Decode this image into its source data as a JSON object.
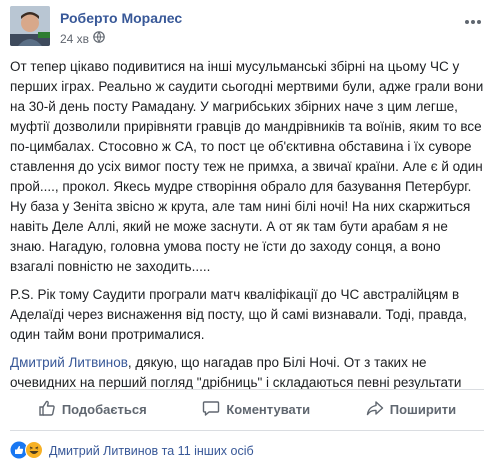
{
  "post": {
    "author": "Роберто Моралес",
    "time": "24 хв",
    "paragraphs": [
      "От тепер цікаво подивитися на інші мусульманські збірні на цьому ЧС у перших іграх. Реально ж саудити сьогодні мертвими були, адже грали вони на 30-й день посту Рамадану. У магрибських збірних наче з цим легше, муфтії дозволили прирівняти гравців до мандрівників та воїнів, яким то все по-цимбалах. Стосовно ж СА, то пост це об'єктивна обставина і їх суворе ставлення до усіх вимог посту теж не примха, а звичаї країни. Але є й один прой...., прокол. Якесь мудре створіння обрало для базування Петербург. Ну база у Зеніта звісно ж крута, але там нині білі ночі! На них скаржиться навіть Деле Аллі, який не може заснути. А от як там бути арабам я не знаю. Нагадую, головна умова посту не їсти до заходу сонця, а воно взагалі повністю не заходить.....",
      "P.S. Рік тому Саудити програли матч кваліфікації до ЧС австралійцям в Аделаїді через виснаження від посту, що й самі визнавали. Тоді, правда, один тайм вони протрималися."
    ],
    "comment_mention": "Дмитрий Литвинов",
    "comment_text": ", дякую, що нагадав про Білі Ночі. От з таких не очевидних на перший погляд \"дрібниць\" і складаються певні результати"
  },
  "actions": {
    "like": "Подобається",
    "comment": "Коментувати",
    "share": "Поширити"
  },
  "reactions": {
    "summary": "Дмитрий Литвинов та 11 інших осіб"
  },
  "colors": {
    "link": "#385898",
    "muted": "#606770",
    "divider": "#dadde1"
  }
}
